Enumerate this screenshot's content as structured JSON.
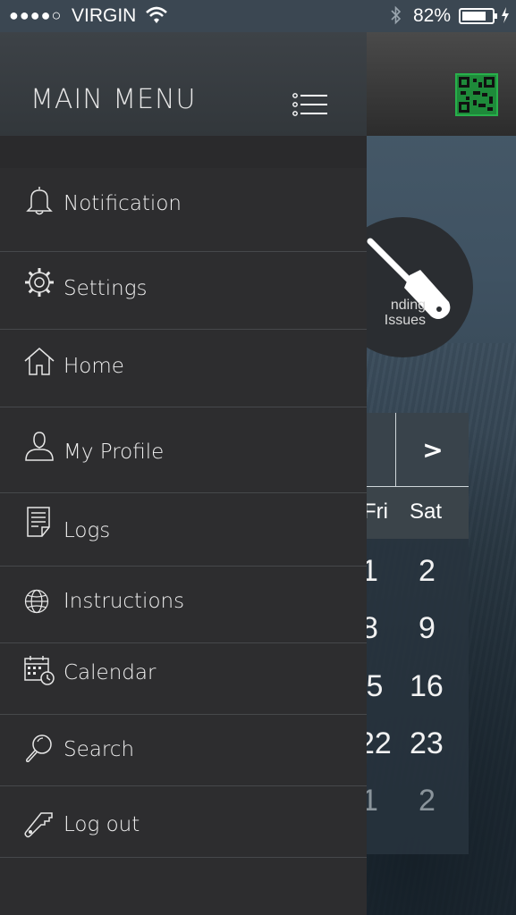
{
  "status_bar": {
    "signal": "●●●●○",
    "carrier": "VIRGIN",
    "battery_percent": "82%",
    "battery_level": 0.82
  },
  "drawer": {
    "title": "MAIN MENU",
    "items": [
      {
        "label": "Notification",
        "icon": "bell-icon"
      },
      {
        "label": "Settings",
        "icon": "gear-icon"
      },
      {
        "label": "Home",
        "icon": "home-icon"
      },
      {
        "label": "My Profile",
        "icon": "user-icon"
      },
      {
        "label": "Logs",
        "icon": "document-icon"
      },
      {
        "label": "Instructions",
        "icon": "globe-icon"
      },
      {
        "label": "Calendar",
        "icon": "calendar-icon"
      },
      {
        "label": "Search",
        "icon": "magnifier-icon"
      },
      {
        "label": "Log out",
        "icon": "key-icon"
      }
    ]
  },
  "background": {
    "pending_label_line1": "nding",
    "pending_label_line2": "Issues",
    "calendar": {
      "next_button": ">",
      "day_headers": [
        "Fri",
        "Sat"
      ],
      "rows": [
        [
          "1",
          "2"
        ],
        [
          "8",
          "9"
        ],
        [
          ".5",
          "16"
        ],
        [
          "22",
          "23"
        ],
        [
          "1",
          "2"
        ]
      ]
    }
  },
  "colors": {
    "drawer_bg": "#2d2d2f",
    "status_bar_bg": "#3b4752",
    "qr_green": "#1e8a3a"
  }
}
